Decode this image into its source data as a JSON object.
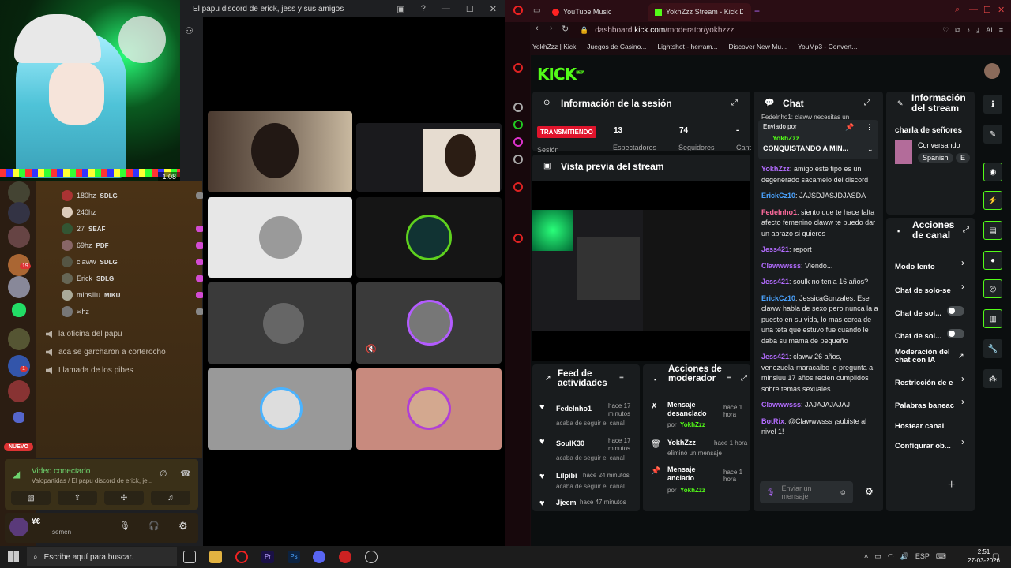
{
  "discord": {
    "window_title": "El papu discord de erick, jess y sus amigos",
    "stream_thumb_time": "1:08",
    "users": [
      {
        "name": "180hz",
        "tag": "SDLG"
      },
      {
        "name": "240hz",
        "tag": ""
      },
      {
        "name": "27",
        "tag": "SEAF"
      },
      {
        "name": "69hz",
        "tag": "PDF"
      },
      {
        "name": "claww",
        "tag": "SDLG"
      },
      {
        "name": "Erick",
        "tag": "SDLG"
      },
      {
        "name": "minsiiiu",
        "tag": "MIKU"
      },
      {
        "name": "∞hz",
        "tag": ""
      }
    ],
    "voice_channels": [
      "la oficina del papu",
      "aca se garcharon a corterocho",
      "Llamada de los pibes"
    ],
    "nuevo_badge": "NUEVO",
    "badges": [
      "19",
      "1"
    ],
    "vc_status": "Video conectado",
    "vc_path": "Valopartidas / El papu discord de erick, je...",
    "self_name": "¥€",
    "self_status": "semen"
  },
  "browser": {
    "tabs": [
      {
        "label": "YouTube Music"
      },
      {
        "label": "YokhZzz Stream - Kick Da"
      }
    ],
    "url_prefix": "dashboard.",
    "url_domain": "kick.com",
    "url_path": "/moderator/yokhzzz",
    "bookmarks": [
      "YokhZzz | Kick",
      "Juegos de Casino...",
      "Lightshot - herram...",
      "Discover New Mu...",
      "YouMp3 - Convert..."
    ],
    "ai_label": "AI"
  },
  "kick": {
    "logo": "KICK",
    "logo_sup": "BETA",
    "session": {
      "title": "Información de la sesión",
      "live": "TRANSMITIENDO",
      "stats": [
        {
          "v": "13",
          "l": "Espectadores"
        },
        {
          "v": "74",
          "l": "Seguidores"
        },
        {
          "v": "-",
          "l": "Cant"
        }
      ],
      "session_label": "Sesión"
    },
    "preview_title": "Vista previa del stream",
    "feed": {
      "title": "Feed de actividades",
      "items": [
        {
          "name": "Fedelnho1",
          "time": "hace 17 minutos",
          "sub": "acaba de seguir el canal"
        },
        {
          "name": "SoulK30",
          "time": "hace 17 minutos",
          "sub": "acaba de seguir el canal"
        },
        {
          "name": "Lilpibi",
          "time": "hace 24 minutos",
          "sub": "acaba de seguir el canal"
        },
        {
          "name": "Jjeem",
          "time": "hace 47 minutos",
          "sub": ""
        }
      ]
    },
    "modactions": {
      "title": "Acciones de moderador",
      "items": [
        {
          "action": "Mensaje desanclado",
          "time": "hace 1 hora",
          "by": "por",
          "user": "YokhZzz"
        },
        {
          "action": "YokhZzz",
          "time": "hace 1 hora",
          "by": "eliminó un mensaje",
          "user": ""
        },
        {
          "action": "Mensaje anclado",
          "time": "hace 1 hora",
          "by": "por",
          "user": "YokhZzz"
        }
      ]
    },
    "chat": {
      "title": "Chat",
      "top_cut": "Fedelnho1: claww necesitas un",
      "pinned": {
        "label": "Enviado por",
        "user": "YokhZzz",
        "text": "CONQUISTANDO A MIN..."
      },
      "messages": [
        {
          "user": "YokhZzz",
          "color": "#b36cff",
          "text": "amigo este tipo es un degenerado sacamelo del discord"
        },
        {
          "user": "ErickCz10",
          "color": "#4aa3ff",
          "text": "JAJSDJASJDJASDA"
        },
        {
          "user": "Fedelnho1",
          "color": "#ff6b9d",
          "text": "siento que te hace falta afecto femenino claww te puedo dar un abrazo si quieres"
        },
        {
          "user": "Jess421",
          "color": "#b36cff",
          "text": "report"
        },
        {
          "user": "Clawwwsss",
          "color": "#b36cff",
          "text": "Viendo..."
        },
        {
          "user": "Jess421",
          "color": "#b36cff",
          "text": "soulk no tenia 16 años?"
        },
        {
          "user": "ErickCz10",
          "color": "#4aa3ff",
          "text": "JessicaGonzales: Ese claww habla de sexo pero nunca la a puesto en su vida, lo mas cerca de una teta que estuvo fue cuando le daba su mama de pequeño"
        },
        {
          "user": "Jess421",
          "color": "#b36cff",
          "text": "claww 26 años, venezuela-maracaibo le pregunta a minsiuu 17 años recien cumplidos sobre temas sexuales"
        },
        {
          "user": "Clawwwsss",
          "color": "#b36cff",
          "text": "JAJAJAJAJAJ"
        },
        {
          "user": "BotRix",
          "color": "#b36cff",
          "text": "@Clawwwsss ¡subiste al nivel 1!"
        }
      ],
      "placeholder": "Enviar un mensaje"
    },
    "stream_info": {
      "title": "Información del stream",
      "stream_title": "charla de señores",
      "category": "Conversando",
      "tags": [
        "Spanish",
        "E"
      ]
    },
    "channel_actions": {
      "title": "Acciones de canal",
      "items": [
        {
          "label": "Modo lento",
          "type": "arrow"
        },
        {
          "label": "Chat de solo-se",
          "type": "arrow"
        },
        {
          "label": "Chat de sol...",
          "type": "toggle"
        },
        {
          "label": "Chat de sol...",
          "type": "toggle"
        },
        {
          "label": "Moderación del chat con IA",
          "type": "link"
        },
        {
          "label": "Restricción de e",
          "type": "arrow"
        },
        {
          "label": "Palabras baneac",
          "type": "arrow"
        },
        {
          "label": "Hostear canal",
          "type": "none"
        },
        {
          "label": "Configurar ob...",
          "type": "arrow"
        }
      ]
    }
  },
  "taskbar": {
    "search_placeholder": "Escribe aquí para buscar.",
    "lang": "ESP",
    "time": "2:51",
    "date": "27-03-2026"
  }
}
